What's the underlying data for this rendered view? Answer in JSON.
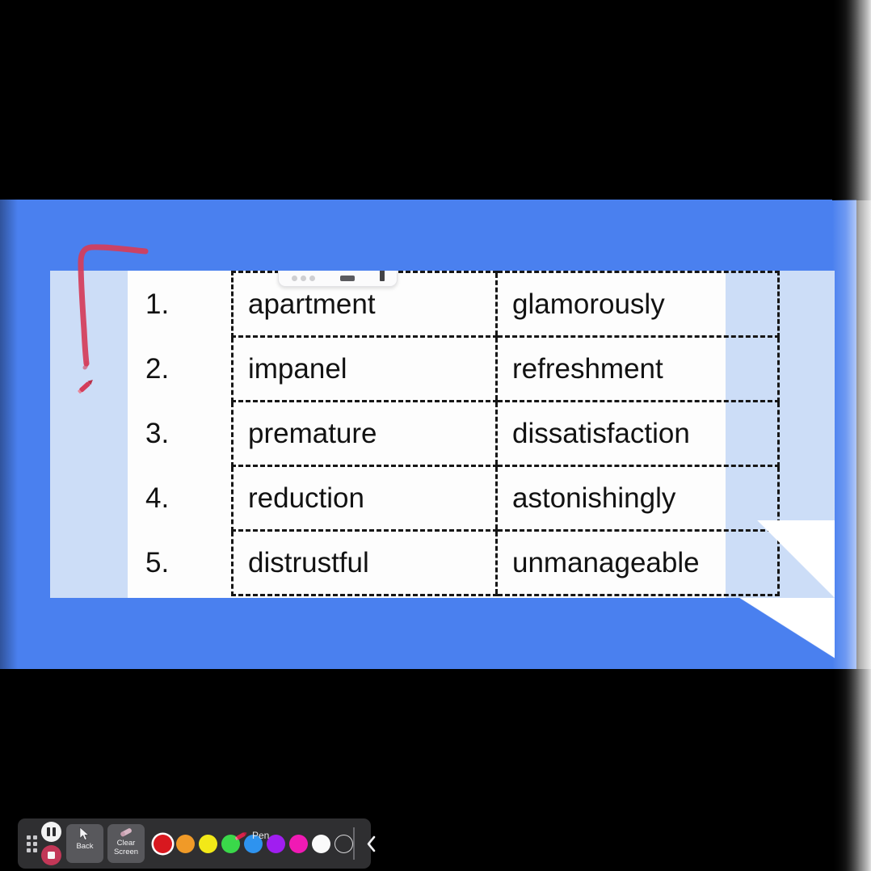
{
  "screen": {
    "backdrop_color": "#4a80ef",
    "letterbox_color": "#000000",
    "page_margin_color": "#ccddf7",
    "page_color": "#fdfdfd"
  },
  "document": {
    "type": "worksheet-table",
    "columns": 3,
    "rows": [
      {
        "number": "1.",
        "word_a": "apartment",
        "word_b": "glamorously"
      },
      {
        "number": "2.",
        "word_a": "impanel",
        "word_b": "refreshment"
      },
      {
        "number": "3.",
        "word_a": "premature",
        "word_b": "dissatisfaction"
      },
      {
        "number": "4.",
        "word_a": "reduction",
        "word_b": "astonishingly"
      },
      {
        "number": "5.",
        "word_a": "distrustful",
        "word_b": "unmanageable"
      }
    ]
  },
  "annotation": {
    "ink_color": "#d43d5a",
    "stroke_width": 7,
    "cursor_icon": "pen-cursor-icon"
  },
  "toolbar": {
    "drag_handle_icon": "drag-handle-icon",
    "pause_icon": "pause-icon",
    "stop_icon": "stop-recording-icon",
    "back_label": "Back",
    "back_icon": "cursor-arrow-icon",
    "clear_label": "Clear\nScreen",
    "clear_line1": "Clear",
    "clear_line2": "Screen",
    "clear_icon": "eraser-icon",
    "pen_label": "Pen",
    "pen_icon": "pen-icon",
    "collapse_icon": "chevron-left-icon",
    "background_color": "#2f2f31",
    "colors": [
      {
        "name": "red",
        "hex": "#d8181f",
        "selected": true
      },
      {
        "name": "orange",
        "hex": "#f09a28",
        "selected": false
      },
      {
        "name": "yellow",
        "hex": "#f2e818",
        "selected": false
      },
      {
        "name": "green",
        "hex": "#3ad84a",
        "selected": false
      },
      {
        "name": "blue",
        "hex": "#2e93ef",
        "selected": false
      },
      {
        "name": "purple",
        "hex": "#a01ef0",
        "selected": false
      },
      {
        "name": "magenta",
        "hex": "#f01ab4",
        "selected": false
      },
      {
        "name": "white",
        "hex": "#fafafa",
        "selected": false
      },
      {
        "name": "transparent",
        "hex": "transparent",
        "selected": false
      }
    ]
  }
}
